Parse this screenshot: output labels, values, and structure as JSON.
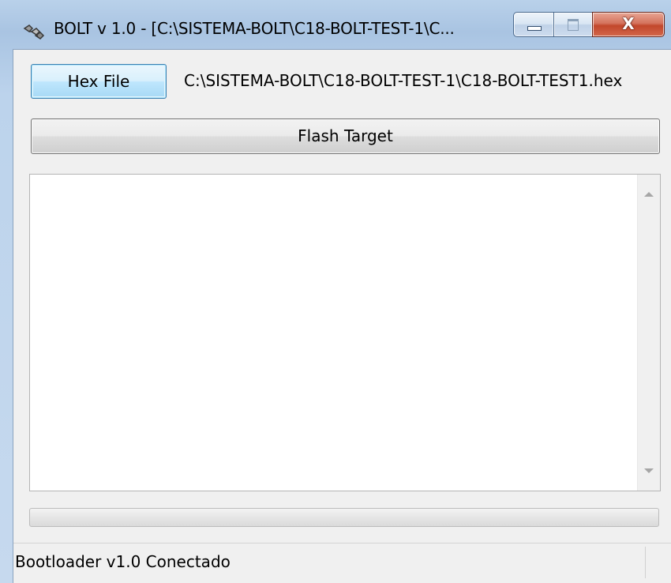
{
  "window": {
    "title": "BOLT v 1.0 - [C:\\SISTEMA-BOLT\\C18-BOLT-TEST-1\\C...",
    "icon": "bolt-app-icon",
    "controls": {
      "minimize_icon": "minimize-icon",
      "maximize_icon": "maximize-icon",
      "close_label": "X"
    }
  },
  "toolbar": {
    "hex_file_label": "Hex File",
    "file_path": "C:\\SISTEMA-BOLT\\C18-BOLT-TEST-1\\C18-BOLT-TEST1.hex"
  },
  "actions": {
    "flash_target_label": "Flash Target"
  },
  "log": {
    "content": ""
  },
  "progress": {
    "value": 0
  },
  "status": {
    "text": "Bootloader v1.0 Conectado"
  },
  "colors": {
    "title_bar": "#b9d1ea",
    "client_bg": "#f0f0f0",
    "close_button": "#c2472c"
  }
}
